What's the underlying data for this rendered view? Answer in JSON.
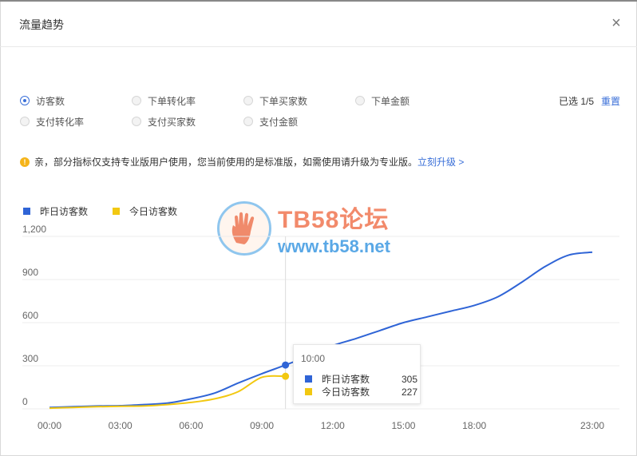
{
  "dialog": {
    "title": "流量趋势"
  },
  "options": [
    {
      "label": "访客数",
      "checked": true
    },
    {
      "label": "下单转化率",
      "checked": false
    },
    {
      "label": "下单买家数",
      "checked": false
    },
    {
      "label": "下单金额",
      "checked": false
    },
    {
      "label": "支付转化率",
      "checked": false
    },
    {
      "label": "支付买家数",
      "checked": false
    },
    {
      "label": "支付金额",
      "checked": false
    }
  ],
  "selection": {
    "info": "已选 1/5",
    "reset_label": "重置"
  },
  "notice": {
    "text": "亲，部分指标仅支持专业版用户使用，您当前使用的是标准版，如需使用请升级为专业版。",
    "link": "立刻升级 >"
  },
  "colors": {
    "yesterday": "#2f64d6",
    "today": "#f2c811",
    "accent": "#3a6fd8"
  },
  "watermark": {
    "line1": "TB58论坛",
    "line2": "www.tb58.net"
  },
  "tooltip": {
    "time": "10:00",
    "rows": [
      {
        "label": "昨日访客数",
        "value": "305"
      },
      {
        "label": "今日访客数",
        "value": "227"
      }
    ]
  },
  "chart_data": {
    "type": "line",
    "x_tick_labels": [
      "00:00",
      "03:00",
      "06:00",
      "09:00",
      "12:00",
      "15:00",
      "18:00",
      "23:00"
    ],
    "y_tick_labels": [
      "0",
      "300",
      "600",
      "900",
      "1,200"
    ],
    "ylim": [
      0,
      1200
    ],
    "grid": true,
    "legend_position": "top-left",
    "series": [
      {
        "name": "昨日访客数",
        "color": "#2f64d6",
        "points": [
          [
            0,
            10
          ],
          [
            1,
            15
          ],
          [
            2,
            20
          ],
          [
            3,
            22
          ],
          [
            4,
            30
          ],
          [
            5,
            40
          ],
          [
            6,
            70
          ],
          [
            7,
            110
          ],
          [
            8,
            180
          ],
          [
            9,
            245
          ],
          [
            10,
            305
          ],
          [
            11,
            370
          ],
          [
            12,
            440
          ],
          [
            13,
            490
          ],
          [
            14,
            545
          ],
          [
            15,
            600
          ],
          [
            16,
            640
          ],
          [
            17,
            680
          ],
          [
            18,
            720
          ],
          [
            19,
            780
          ],
          [
            20,
            880
          ],
          [
            21,
            990
          ],
          [
            22,
            1070
          ],
          [
            23,
            1090
          ]
        ]
      },
      {
        "name": "今日访客数",
        "color": "#f2c811",
        "points": [
          [
            0,
            5
          ],
          [
            1,
            10
          ],
          [
            2,
            15
          ],
          [
            3,
            18
          ],
          [
            4,
            20
          ],
          [
            5,
            30
          ],
          [
            6,
            45
          ],
          [
            7,
            70
          ],
          [
            8,
            120
          ],
          [
            9,
            220
          ],
          [
            10,
            227
          ]
        ]
      }
    ],
    "highlight_x": 10
  }
}
